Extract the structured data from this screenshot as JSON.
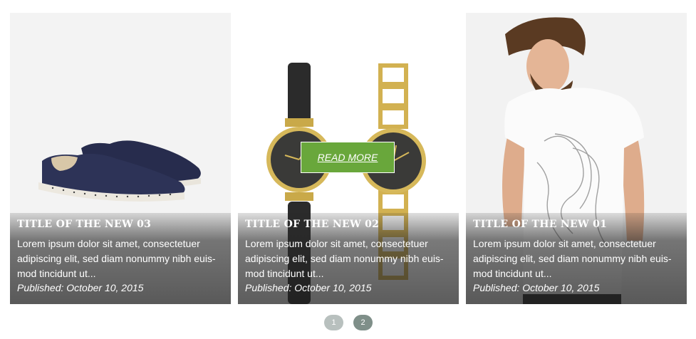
{
  "cards": [
    {
      "title": "Title of the new 03",
      "description": "Lorem ipsum dolor sit amet, consectetuer adipiscing elit, sed diam nonummy nibh euis-mod tincidunt ut...",
      "published": "Published: October 10, 2015",
      "image": "slip-on-shoes-image"
    },
    {
      "title": "Title of the new 02",
      "description": "Lorem ipsum dolor sit amet, consectetuer adipiscing elit, sed diam nonummy nibh euis-mod tincidunt ut...",
      "published": "Published: October 10, 2015",
      "image": "watches-image",
      "read_more": "READ MORE"
    },
    {
      "title": "Title of the new 01",
      "description": "Lorem ipsum dolor sit amet, consectetuer adipiscing elit, sed diam nonummy nibh euis-mod tincidunt ut...",
      "published": "Published: October 10, 2015",
      "image": "man-tshirt-image"
    }
  ],
  "pager": {
    "pages": [
      "1",
      "2"
    ],
    "active": "2"
  },
  "colors": {
    "accent": "#69a73b",
    "pager_active": "#7f8f89",
    "pager_inactive": "#b8c0be"
  }
}
